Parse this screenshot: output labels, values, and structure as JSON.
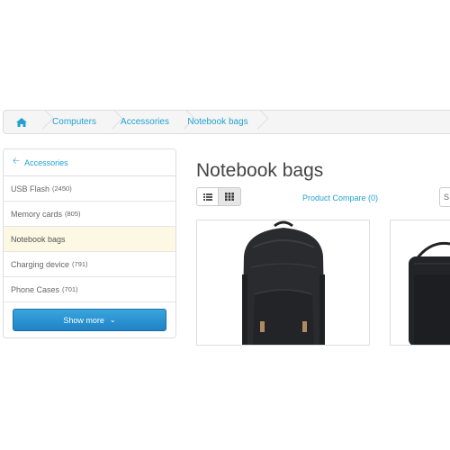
{
  "breadcrumb": {
    "home_icon": "home-icon",
    "items": [
      "Computers",
      "Accessories",
      "Notebook bags"
    ]
  },
  "sidebar": {
    "back_label": "Accessories",
    "items": [
      {
        "label": "USB Flash",
        "count": "(2450)"
      },
      {
        "label": "Memory cards",
        "count": "(805)"
      },
      {
        "label": "Notebook bags",
        "count": ""
      },
      {
        "label": "Charging device",
        "count": "(791)"
      },
      {
        "label": "Phone Cases",
        "count": "(701)"
      }
    ],
    "show_more_label": "Show more"
  },
  "main": {
    "title": "Notebook bags",
    "compare_label": "Product Compare (0)",
    "sort_stub": "S",
    "view_modes": [
      "list-icon",
      "grid-icon"
    ],
    "active_view": "grid"
  },
  "colors": {
    "link": "#23a1d1",
    "active_bg": "#fcf8e3",
    "button": "#2a8fd0"
  }
}
